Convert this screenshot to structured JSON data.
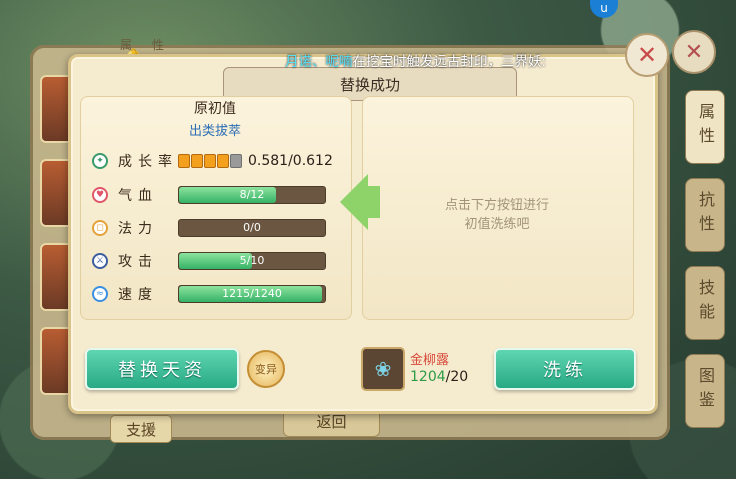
{
  "background": {
    "back_panel_title": "属 性",
    "top_icon": "u",
    "support_button": "支援",
    "return_button": "返回",
    "side_tabs": [
      {
        "label": "属性"
      },
      {
        "label": "抗性"
      },
      {
        "label": "技能"
      },
      {
        "label": "图鉴"
      }
    ]
  },
  "marquee": {
    "names": "月诺、呢喃",
    "message": "在挖宝时触发远古封印，三界妖:"
  },
  "dialog": {
    "title": "替换成功",
    "original": {
      "heading": "原初值",
      "grade": "出类拔萃"
    },
    "stats": [
      {
        "label": "成长率",
        "icon": "leaf-icon",
        "color": "#3a9a6a",
        "value_text": "0.581/0.612",
        "pips_on": 4,
        "pips_total": 5
      },
      {
        "label": "气血",
        "icon": "heart-icon",
        "color": "#e0566a",
        "value_text": "8/12",
        "fraction": 0.667
      },
      {
        "label": "法力",
        "icon": "mana-icon",
        "color": "#e3a13a",
        "value_text": "0/0",
        "fraction": 0.0
      },
      {
        "label": "攻击",
        "icon": "sword-icon",
        "color": "#3d5e9e",
        "value_text": "5/10",
        "fraction": 0.5
      },
      {
        "label": "速度",
        "icon": "wind-icon",
        "color": "#3b8fe0",
        "value_text": "1215/1240",
        "fraction": 0.98
      }
    ],
    "hint": "点击下方按钮进行\n初值洗练吧",
    "replace_button": "替换天资",
    "coin_label": "变异",
    "item": {
      "name": "金柳露",
      "have": "1204",
      "need": "/20"
    },
    "wash_button": "洗练"
  },
  "colors": {
    "accent_green": "#27a984",
    "panel_bg": "#f5ebcf",
    "item_name_red": "#d84a3a",
    "marquee_name_cyan": "#55e0f7"
  }
}
